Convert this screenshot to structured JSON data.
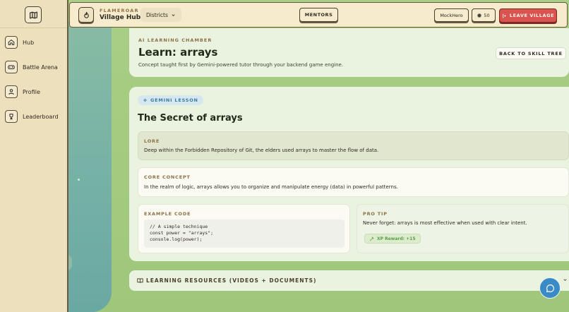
{
  "sidebar": {
    "logo_icon": "map-icon",
    "items": [
      {
        "label": "Hub",
        "icon": "home-icon"
      },
      {
        "label": "Battle Arena",
        "icon": "gamepad-icon"
      },
      {
        "label": "Profile",
        "icon": "user-icon"
      },
      {
        "label": "Leaderboard",
        "icon": "trophy-icon"
      }
    ]
  },
  "header": {
    "brand_kicker": "FLAMEROAR",
    "brand_name": "Village Hub",
    "districts_label": "Districts",
    "mentors_label": "MENTORS",
    "username": "MockHero",
    "coins": "50",
    "leave_label": "LEAVE VILLAGE"
  },
  "chamber": {
    "kicker": "AI LEARNING CHAMBER",
    "title": "Learn: arrays",
    "description": "Concept taught first by Gemini-powered tutor through your backend game engine.",
    "back_label": "BACK TO SKILL TREE"
  },
  "lesson": {
    "badge": "GEMINI LESSON",
    "title": "The Secret of arrays",
    "lore_label": "LORE",
    "lore_text": "Deep within the Forbidden Repository of Git, the elders used arrays to master the flow of data.",
    "core_label": "CORE CONCEPT",
    "core_text": "In the realm of logic, arrays allows you to organize and manipulate energy (data) in powerful patterns.",
    "code_label": "EXAMPLE CODE",
    "code_lines": [
      "// A simple technique",
      "const power = \"arrays\";",
      "console.log(power);"
    ],
    "tip_label": "PRO TIP",
    "tip_text": "Never forget: arrays is most effective when used with clear intent.",
    "xp_label": "XP Reward: +15"
  },
  "resources": {
    "label": "LEARNING RESOURCES (VIDEOS + DOCUMENTS)"
  },
  "colors": {
    "accent_red": "#d9534f",
    "kicker_brown": "#8c7044",
    "gemini_blue": "#3d7a98",
    "xp_green": "#5e9a4a",
    "chat_blue": "#3a8ac6"
  }
}
